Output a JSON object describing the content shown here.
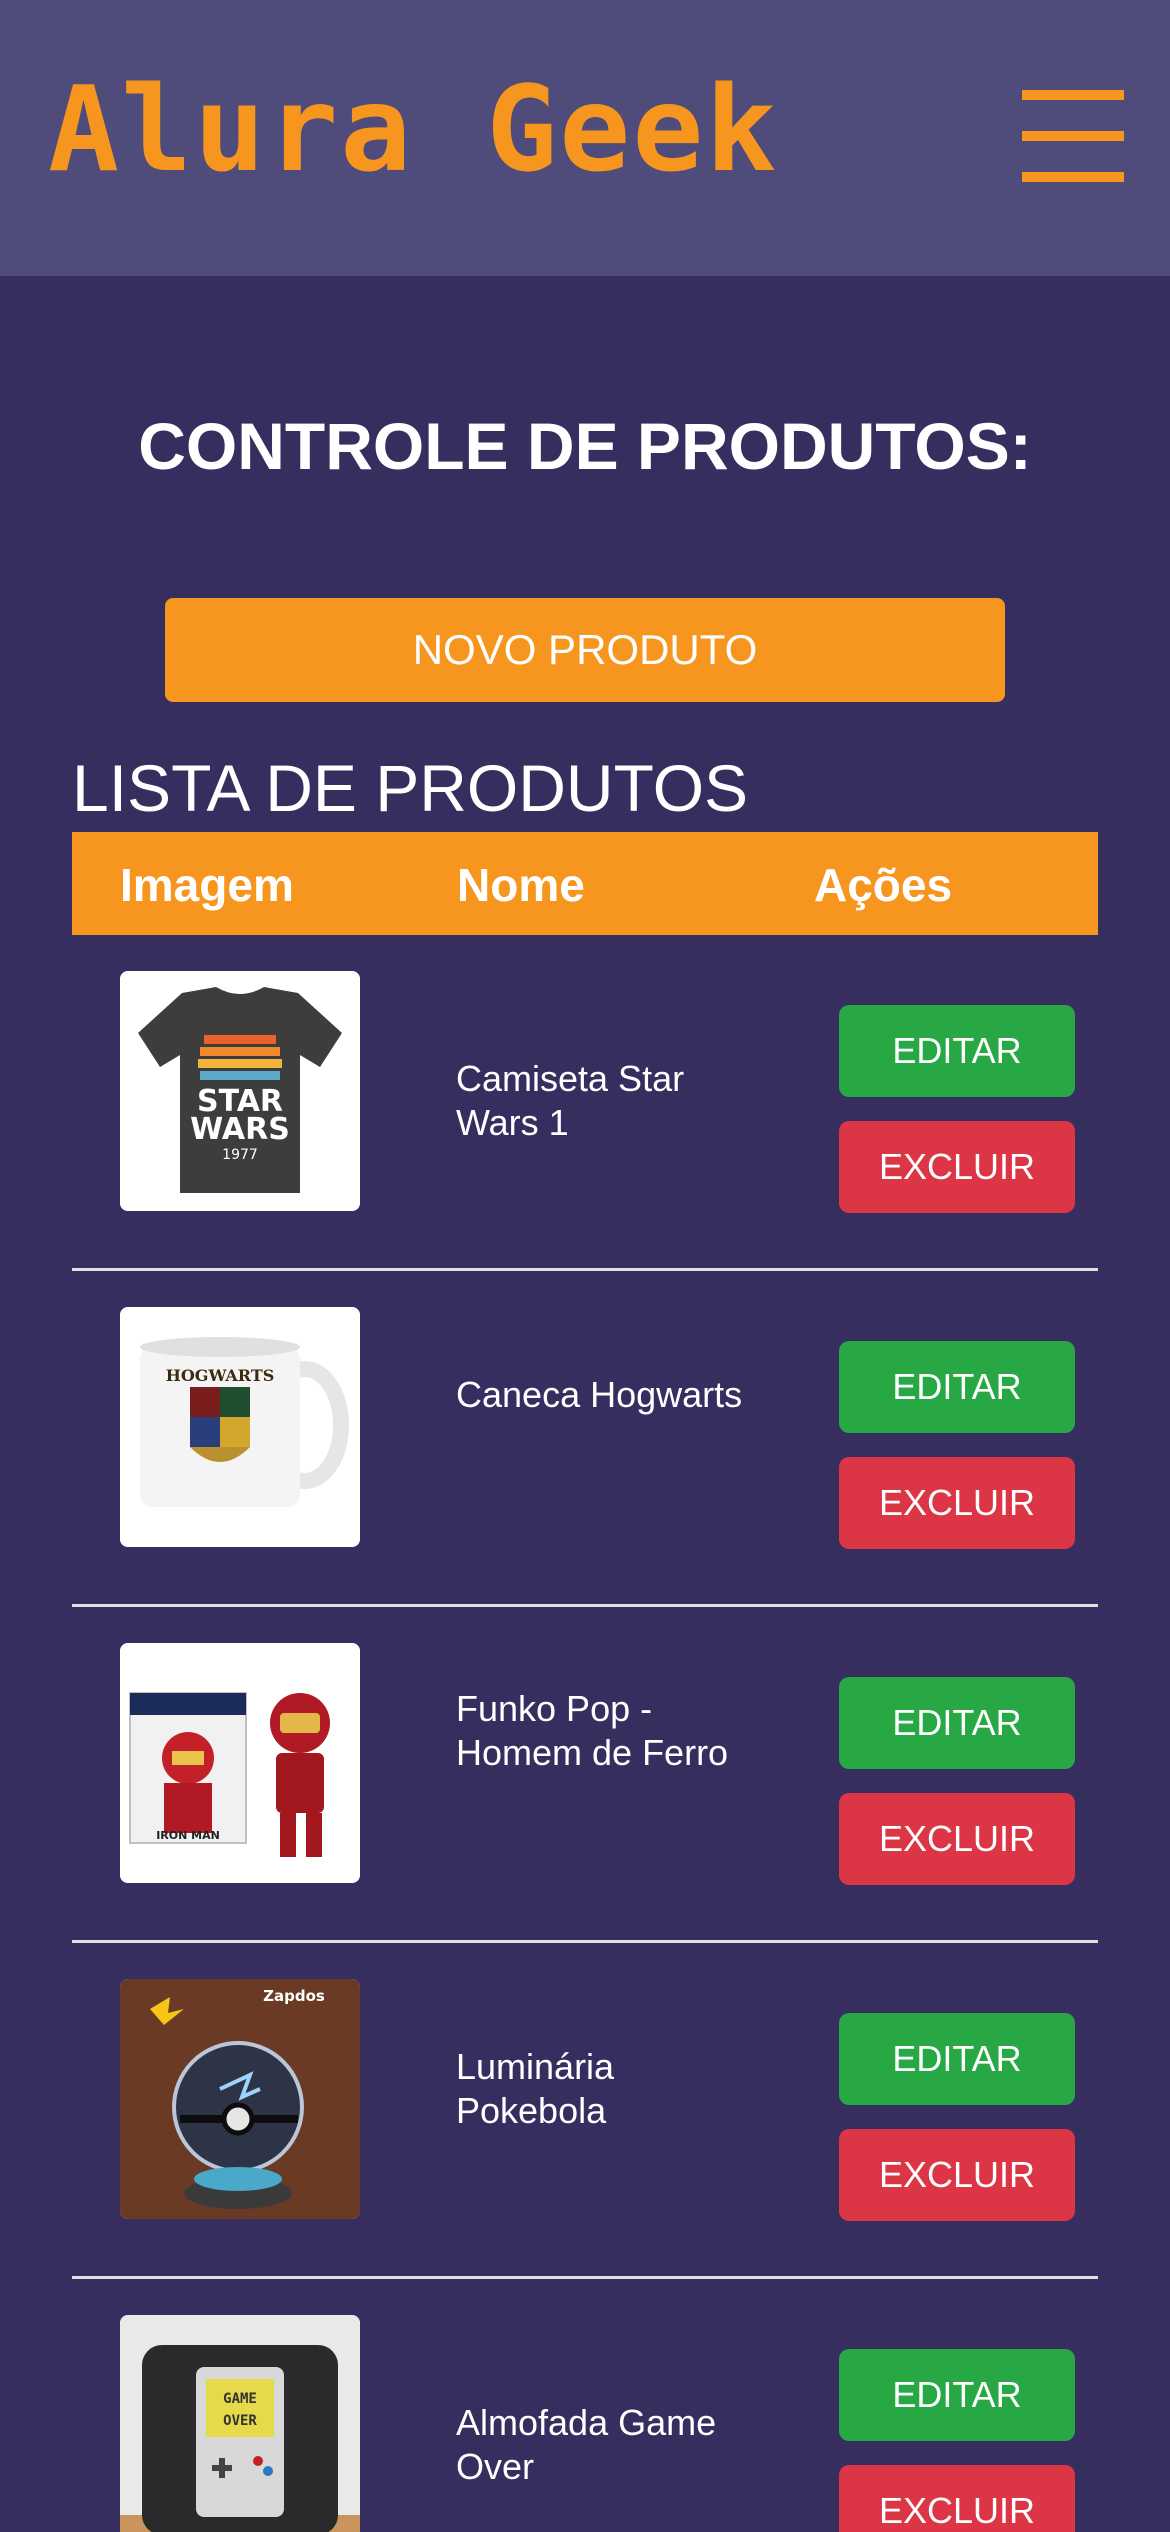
{
  "header": {
    "logo": "Alura Geek",
    "menu_icon": "hamburger-menu-icon"
  },
  "main": {
    "title": "CONTROLE DE PRODUTOS:",
    "new_button": "NOVO PRODUTO",
    "list_title": "LISTA DE PRODUTOS",
    "columns": [
      "Imagem",
      "Nome",
      "Ações"
    ]
  },
  "products": [
    {
      "name": "Camiseta Star Wars 1",
      "image": "star-wars-tshirt-image",
      "edit": "EDITAR",
      "delete": "EXCLUIR"
    },
    {
      "name": "Caneca Hogwarts",
      "image": "hogwarts-mug-image",
      "edit": "EDITAR",
      "delete": "EXCLUIR"
    },
    {
      "name": "Funko Pop - Homem de Ferro",
      "image": "iron-man-funko-image",
      "edit": "EDITAR",
      "delete": "EXCLUIR"
    },
    {
      "name": "Luminária Pokebola",
      "image": "pokeball-lamp-image",
      "edit": "EDITAR",
      "delete": "EXCLUIR"
    },
    {
      "name": "Almofada Game Over",
      "image": "game-over-pillow-image",
      "edit": "EDITAR",
      "delete": "EXCLUIR"
    }
  ],
  "image_text": {
    "tshirt_line1": "STAR",
    "tshirt_line2": "WARS",
    "tshirt_year": "1977",
    "mug_label": "HOGWARTS",
    "funko_label": "IRON MAN",
    "lamp_label": "Zapdos",
    "pillow_label_1": "GAME",
    "pillow_label_2": "OVER"
  },
  "colors": {
    "background": "#352e5f",
    "header": "#4f4c7c",
    "accent": "#f7961f",
    "edit": "#27a844",
    "delete": "#dc3545"
  }
}
